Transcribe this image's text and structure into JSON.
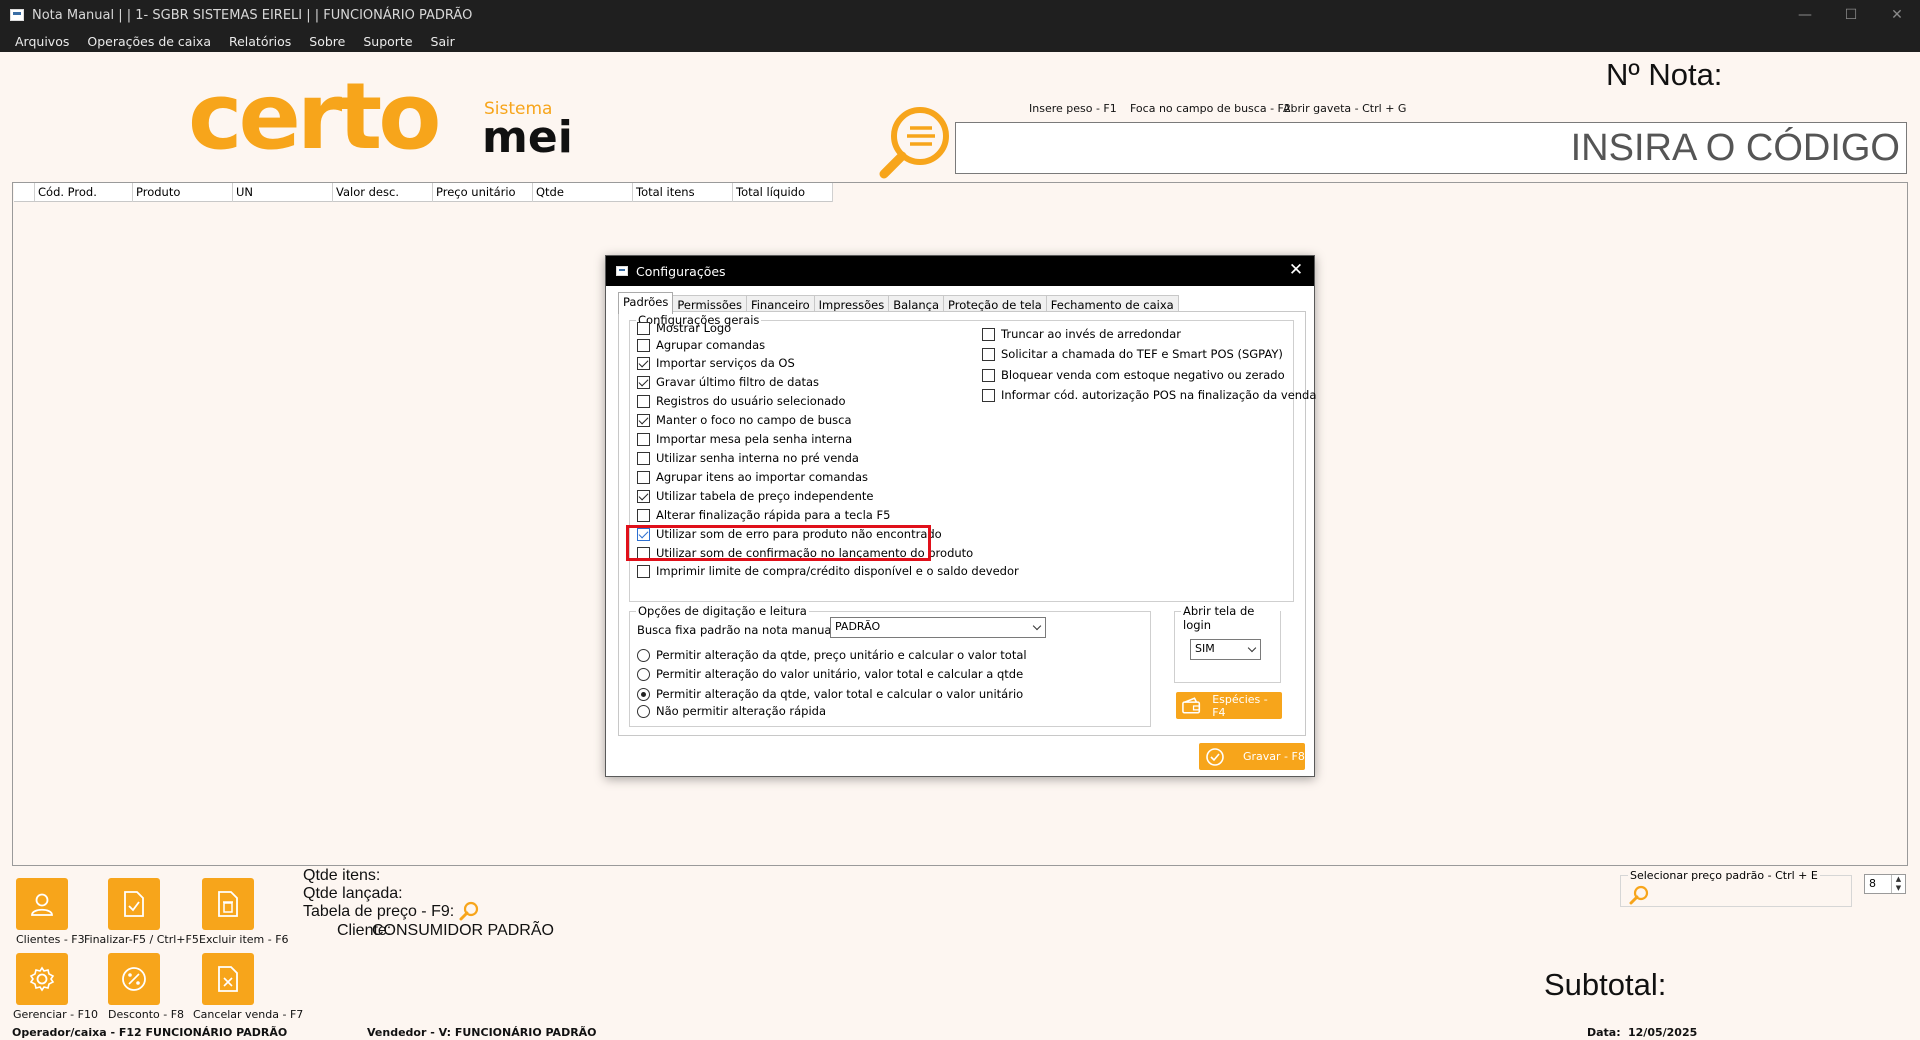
{
  "window": {
    "title": "Nota Manual | | 1- SGBR SISTEMAS EIRELI | | FUNCIONÁRIO PADRÃO",
    "minimize": "—",
    "maximize": "☐",
    "close": "✕"
  },
  "menu": [
    "Arquivos",
    "Operações de caixa",
    "Relatórios",
    "Sobre",
    "Suporte",
    "Sair"
  ],
  "logo": {
    "brand": "certo",
    "sistema": "Sistema",
    "mei": "mei",
    "brand_color": "#f7a51b"
  },
  "header": {
    "nota_label": "Nº Nota:",
    "shortcut_peso": "Insere peso - F1",
    "shortcut_busca": "Foca no campo de busca - F2",
    "shortcut_gaveta": "Abrir gaveta - Ctrl + G",
    "code_placeholder": "INSIRA O CÓDIGO"
  },
  "grid": {
    "columns": [
      "Cód. Prod.",
      "Produto",
      "UN",
      "Valor desc.",
      "Preço unitário",
      "Qtde",
      "Total itens",
      "Total líquido"
    ]
  },
  "dialog": {
    "title": "Configurações",
    "tabs": [
      "Padrões",
      "Permissões",
      "Financeiro",
      "Impressões",
      "Balança",
      "Proteção de tela",
      "Fechamento de caixa"
    ],
    "active_tab": "Padrões",
    "general_title": "Configurações gerais",
    "left_checks": [
      {
        "label": "Mostrar Logo",
        "checked": false
      },
      {
        "label": "Agrupar comandas",
        "checked": false
      },
      {
        "label": "Importar serviços da OS",
        "checked": true
      },
      {
        "label": "Gravar último filtro de datas",
        "checked": true
      },
      {
        "label": "Registros do usuário selecionado",
        "checked": false
      },
      {
        "label": "Manter o foco no campo de busca",
        "checked": true
      },
      {
        "label": "Importar mesa pela senha interna",
        "checked": false
      },
      {
        "label": "Utilizar senha interna no pré venda",
        "checked": false
      },
      {
        "label": "Agrupar itens ao importar comandas",
        "checked": false
      },
      {
        "label": "Utilizar tabela de preço independente",
        "checked": true
      },
      {
        "label": "Alterar finalização rápida para a tecla F5",
        "checked": false
      },
      {
        "label": "Utilizar som de erro para produto não encontrado",
        "checked": true
      },
      {
        "label": "Utilizar som de confirmação no lançamento do produto",
        "checked": false
      },
      {
        "label": "Imprimir limite de compra/crédito disponível e o saldo devedor",
        "checked": false
      }
    ],
    "right_checks": [
      {
        "label": "Truncar ao invés de arredondar",
        "checked": false
      },
      {
        "label": "Solicitar a chamada do TEF e Smart POS (SGPAY)",
        "checked": false
      },
      {
        "label": "Bloquear venda com estoque negativo ou zerado",
        "checked": false
      },
      {
        "label": "Informar cód. autorização POS na finalização da venda",
        "checked": false
      }
    ],
    "typing_title": "Opções de digitação e leitura",
    "busca_label": "Busca fixa padrão na nota manual por:",
    "busca_value": "PADRÃO",
    "radios": [
      {
        "label": "Permitir alteração da qtde, preço unitário e calcular o valor total",
        "selected": false
      },
      {
        "label": "Permitir alteração do valor unitário, valor total e calcular a qtde",
        "selected": false
      },
      {
        "label": "Permitir alteração da qtde, valor total e calcular o valor unitário",
        "selected": true
      },
      {
        "label": "Não permitir alteração rápida",
        "selected": false
      }
    ],
    "login_title": "Abrir tela de login",
    "login_value": "SIM",
    "especies_btn": "Espécies - F4",
    "gravar_btn": "Gravar - F8",
    "highlight_color": "#e0101a"
  },
  "bottom": {
    "tiles": [
      {
        "label": "Clientes - F3",
        "icon": "user-icon"
      },
      {
        "label": "Finalizar-F5 / Ctrl+F5",
        "icon": "doc-check-icon"
      },
      {
        "label": "Excluir item - F6",
        "icon": "trash-icon"
      },
      {
        "label": "Gerenciar - F10",
        "icon": "gear-icon"
      },
      {
        "label": "Desconto - F8",
        "icon": "percent-icon"
      },
      {
        "label": "Cancelar venda - F7",
        "icon": "doc-x-icon"
      }
    ],
    "qtde_itens": "Qtde itens:",
    "qtde_lancada": "Qtde lançada:",
    "tabela_preco": "Tabela de preço - F9:",
    "cliente_label": "Cliente:",
    "cliente_value": "CONSUMIDOR PADRÃO",
    "preco_label": "Selecionar preço padrão - Ctrl + E",
    "spin_value": "8",
    "subtotal_label": "Subtotal:",
    "operador": "Operador/caixa - F12 FUNCIONÁRIO PADRÃO",
    "vendedor": "Vendedor - V: FUNCIONÁRIO PADRÃO",
    "data_label": "Data:",
    "data_value": "12/05/2025"
  }
}
